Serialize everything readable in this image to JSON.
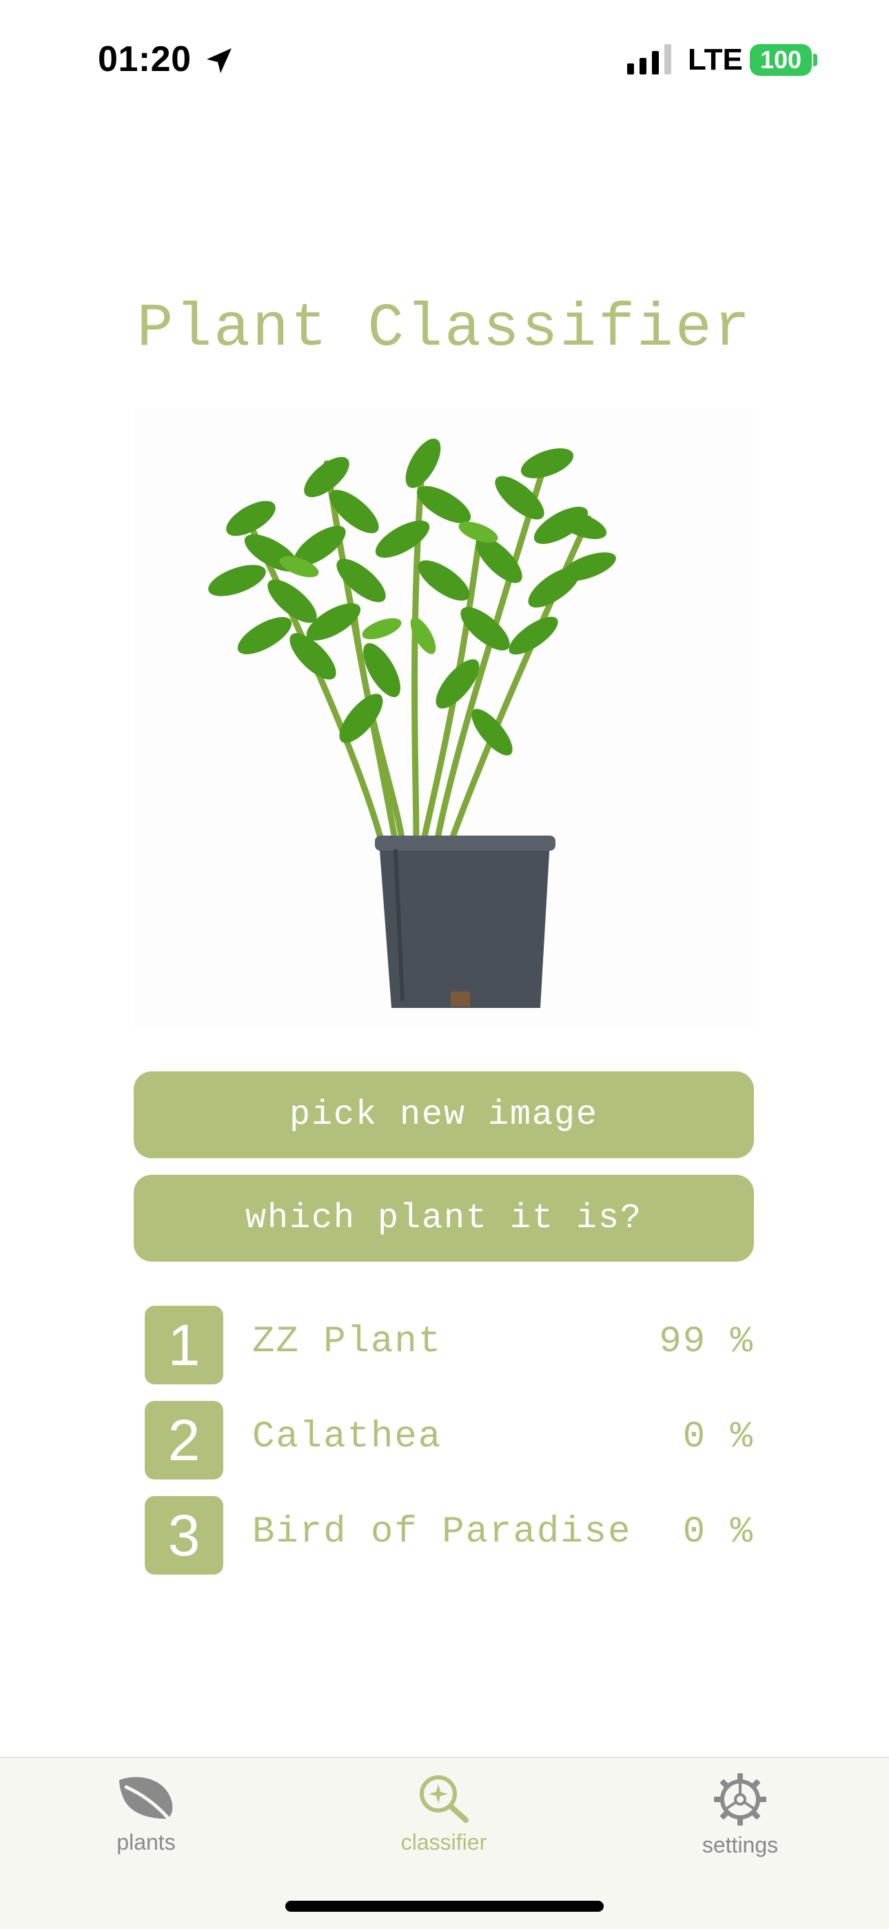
{
  "status_bar": {
    "time": "01:20",
    "network": "LTE",
    "battery": "100",
    "location_icon": "location-arrow-icon"
  },
  "title": "Plant Classifier",
  "image": {
    "description_icon": "potted-plant-image"
  },
  "buttons": {
    "pick": "pick new image",
    "which": "which plant it is?"
  },
  "results": [
    {
      "rank": "1",
      "name": "ZZ Plant",
      "percent": "99 %"
    },
    {
      "rank": "2",
      "name": "Calathea",
      "percent": "0 %"
    },
    {
      "rank": "3",
      "name": "Bird of Paradise",
      "percent": "0 %"
    }
  ],
  "tabs": [
    {
      "label": "plants",
      "icon": "leaf-icon",
      "active": false
    },
    {
      "label": "classifier",
      "icon": "magnifier-sparkle-icon",
      "active": true
    },
    {
      "label": "settings",
      "icon": "gear-icon",
      "active": false
    }
  ],
  "colors": {
    "accent": "#b1c17b",
    "active_tab": "#b3c17d",
    "inactive_tab": "#8a8a8a",
    "battery": "#34c759"
  }
}
